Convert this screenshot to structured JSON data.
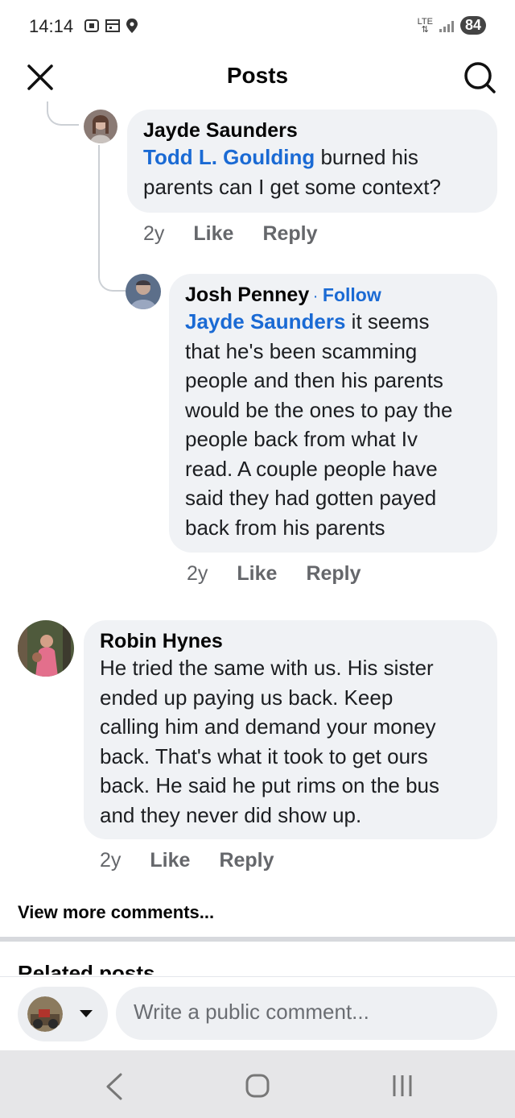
{
  "status_bar": {
    "time": "14:14",
    "network": "LTE",
    "battery": "84"
  },
  "header": {
    "title": "Posts"
  },
  "comments": [
    {
      "author": "Jayde Saunders",
      "mention": "Todd L. Goulding",
      "text_line1": " burned his",
      "text_line2": "parents can I get some context?",
      "time": "2y",
      "like": "Like",
      "reply": "Reply"
    },
    {
      "author": "Josh Penney",
      "follow": "Follow",
      "mention": "Jayde Saunders",
      "lines": [
        " it seems",
        "that he's been scamming",
        "people and then his parents",
        "would be the ones to pay the",
        "people back from what Iv",
        "read. A couple people have",
        "said they had gotten payed",
        "back from his parents"
      ],
      "time": "2y",
      "like": "Like",
      "reply": "Reply"
    },
    {
      "author": "Robin Hynes",
      "lines": [
        "He tried  the same with us. His sister",
        "ended  up paying us back. Keep",
        "calling him and demand your money",
        "back. That's what it took to get ours",
        "back. He said he put rims  on the bus",
        "and they never did show up."
      ],
      "time": "2y",
      "like": "Like",
      "reply": "Reply"
    }
  ],
  "view_more": "View more comments...",
  "related_heading": "Related posts",
  "composer": {
    "placeholder": "Write a public comment..."
  },
  "icons": {
    "close": "close-icon",
    "search": "search-icon",
    "back": "back-icon",
    "home": "home-icon",
    "recents": "recents-icon"
  },
  "colors": {
    "link_blue": "#1a6ad4",
    "bubble_bg": "#f0f2f5",
    "meta_gray": "#65676b"
  }
}
